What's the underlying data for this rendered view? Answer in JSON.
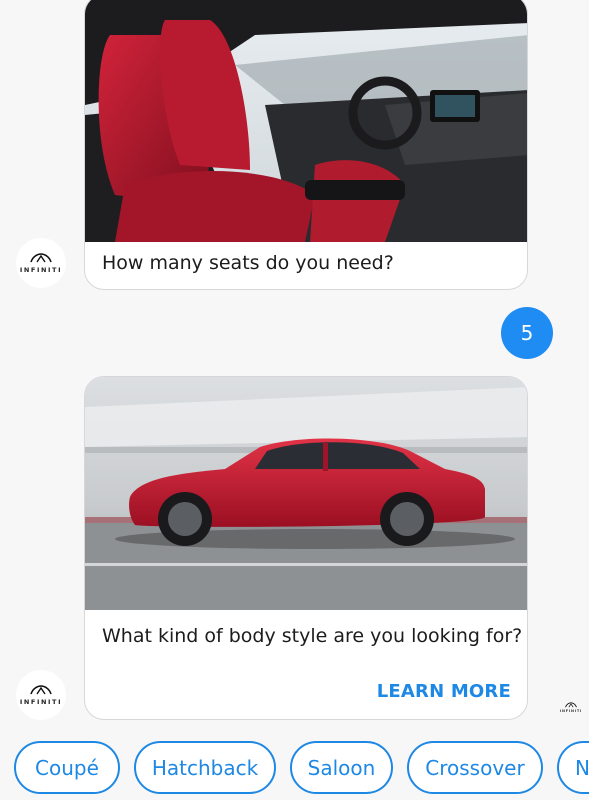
{
  "brand": {
    "name": "INFINITI"
  },
  "messages": [
    {
      "question": "How many seats do you need?"
    },
    {
      "question": "What kind of body style are you looking for?",
      "action_label": "LEARN MORE"
    }
  ],
  "user_reply": {
    "text": "5"
  },
  "quick_replies": [
    "Coupé",
    "Hatchback",
    "Saloon",
    "Crossover",
    "N"
  ],
  "colors": {
    "accent": "#1e88e5",
    "user_bubble": "#1f8cf3",
    "car_red": "#c8102e"
  }
}
